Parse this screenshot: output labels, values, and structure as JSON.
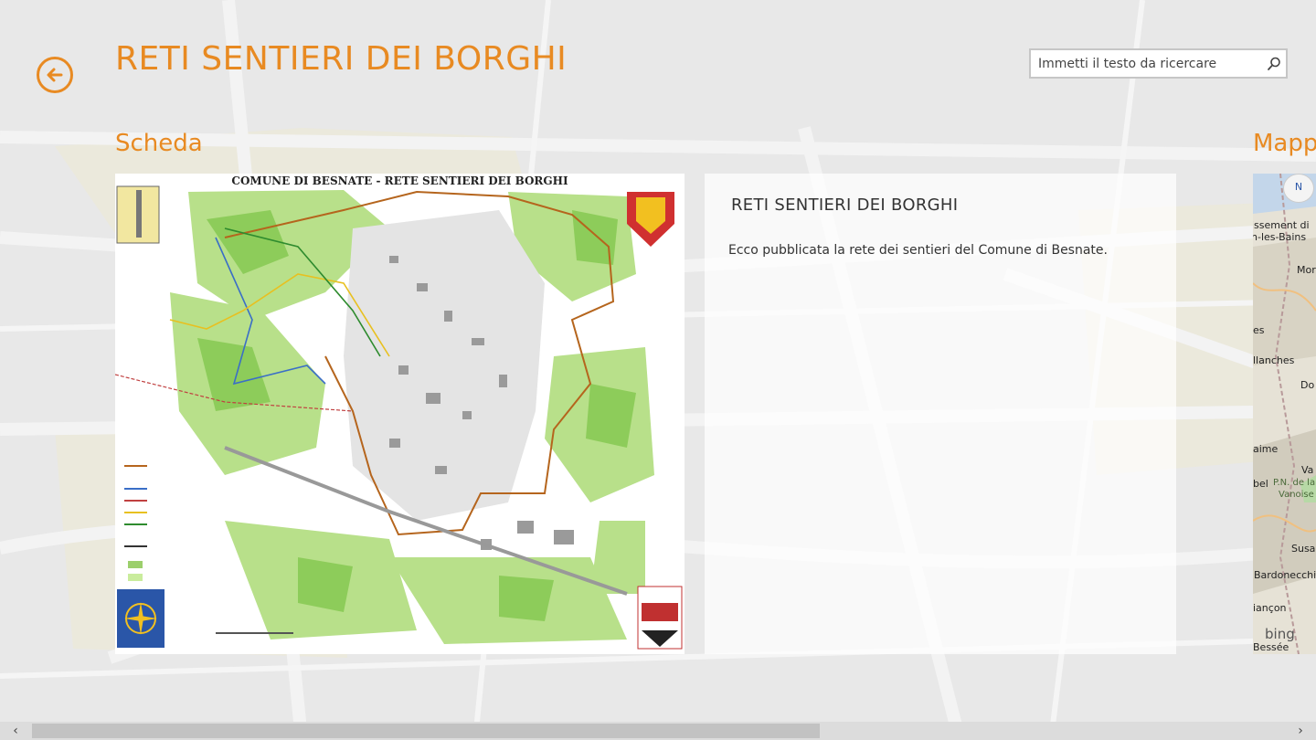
{
  "header": {
    "title": "RETI SENTIERI DEI BORGHI",
    "back_icon": "back-arrow-icon"
  },
  "search": {
    "placeholder": "Immetti il testo da ricercare",
    "icon": "search-icon"
  },
  "sections": {
    "scheda": {
      "label": "Scheda"
    },
    "mappa": {
      "label": "Mapp"
    }
  },
  "map_image": {
    "caption": "COMUNE DI BESNATE - RETE SENTIERI DEI BORGHI"
  },
  "info": {
    "title": "RETI SENTIERI DEI BORGHI",
    "text": "Ecco pubblicata la rete dei sentieri del Comune di Besnate."
  },
  "mini_map": {
    "compass": "N",
    "labels": [
      "issement di",
      "n-les-Bains",
      "Mor",
      "es",
      "llanches",
      "Do",
      "aime",
      "Va",
      "bel",
      "P.N. de la",
      "Vanoise",
      "Susa",
      "Bardonecchia",
      "iançon",
      "bing",
      "Bessée"
    ],
    "logo_icon": "bing-logo-icon"
  },
  "scrollbar": {
    "left_arrow": "‹",
    "right_arrow": "›"
  },
  "colors": {
    "accent": "#e88a22",
    "background": "#e6e6e6"
  }
}
